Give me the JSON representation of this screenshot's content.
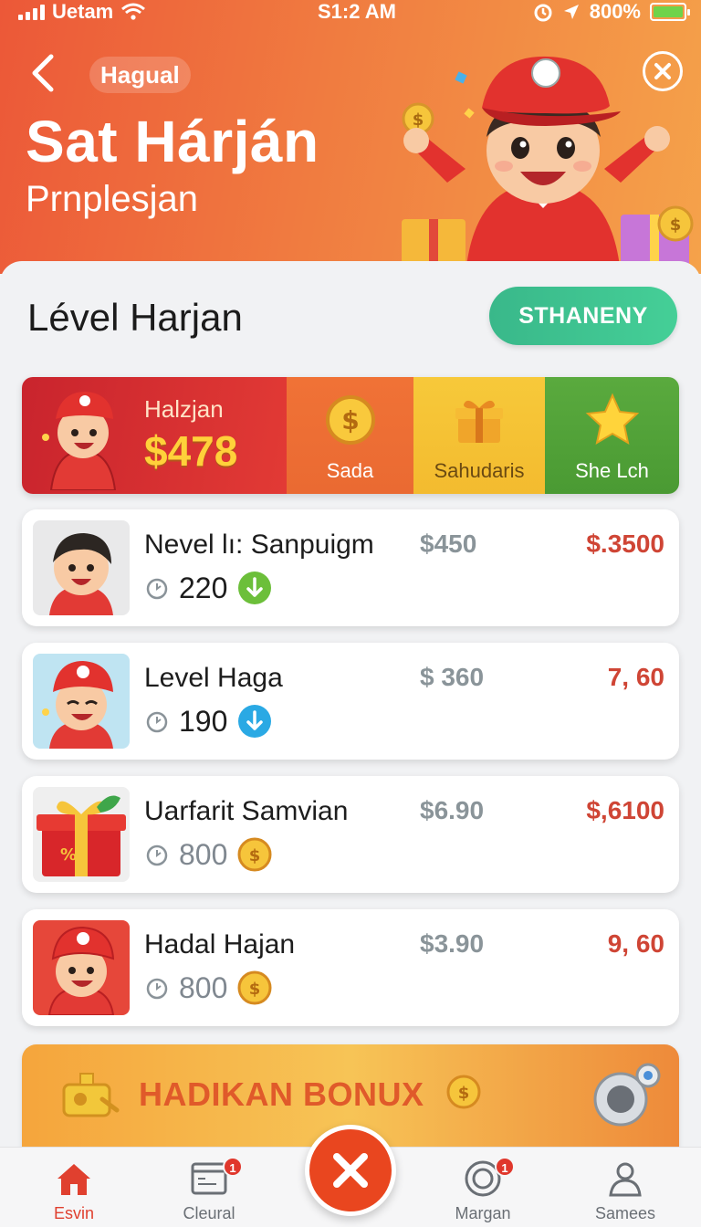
{
  "status_bar": {
    "carrier": "Uetam",
    "time": "S1:2 AM",
    "battery": "800%"
  },
  "hero": {
    "tag": "Hagual",
    "title": "Sat Hárján",
    "subtitle": "Prnplesjan"
  },
  "section": {
    "title": "Lével Harjan",
    "action": "STHANENY"
  },
  "summary": {
    "label": "Halzjan",
    "value": "$478",
    "cells": [
      {
        "label": "Sada",
        "icon": "coin-icon"
      },
      {
        "label": "Sahudaris",
        "icon": "gift-icon"
      },
      {
        "label": "She Lch",
        "icon": "star-icon"
      }
    ]
  },
  "items": [
    {
      "name": "Nevel lı: Sanpuigm",
      "count": "220",
      "price": "$450",
      "right": "$.3500",
      "badge": "green-arrow-icon"
    },
    {
      "name": "Level Haga",
      "count": "190",
      "price": "$ 360",
      "right": "7, 60",
      "badge": "blue-arrow-icon"
    },
    {
      "name": "Uarfarit Samvian",
      "count": "800",
      "price": "$6.90",
      "right": "$,6100",
      "badge": "coin-icon"
    },
    {
      "name": "Hadal Hajan",
      "count": "800",
      "price": "$3.90",
      "right": "9, 60",
      "badge": "coin-icon"
    }
  ],
  "bonus": {
    "label": "HADIKAN BONUX"
  },
  "tabs": [
    {
      "label": "Esvin",
      "icon": "home-icon",
      "active": true
    },
    {
      "label": "Cleural",
      "icon": "browser-icon",
      "badge": "1"
    },
    {
      "label": "Margan",
      "icon": "target-icon",
      "badge": "1"
    },
    {
      "label": "Samees",
      "icon": "person-icon"
    }
  ],
  "colors": {
    "accent": "#e9461f",
    "action_green": "#3dbf8e",
    "price_red": "#cf4535"
  }
}
